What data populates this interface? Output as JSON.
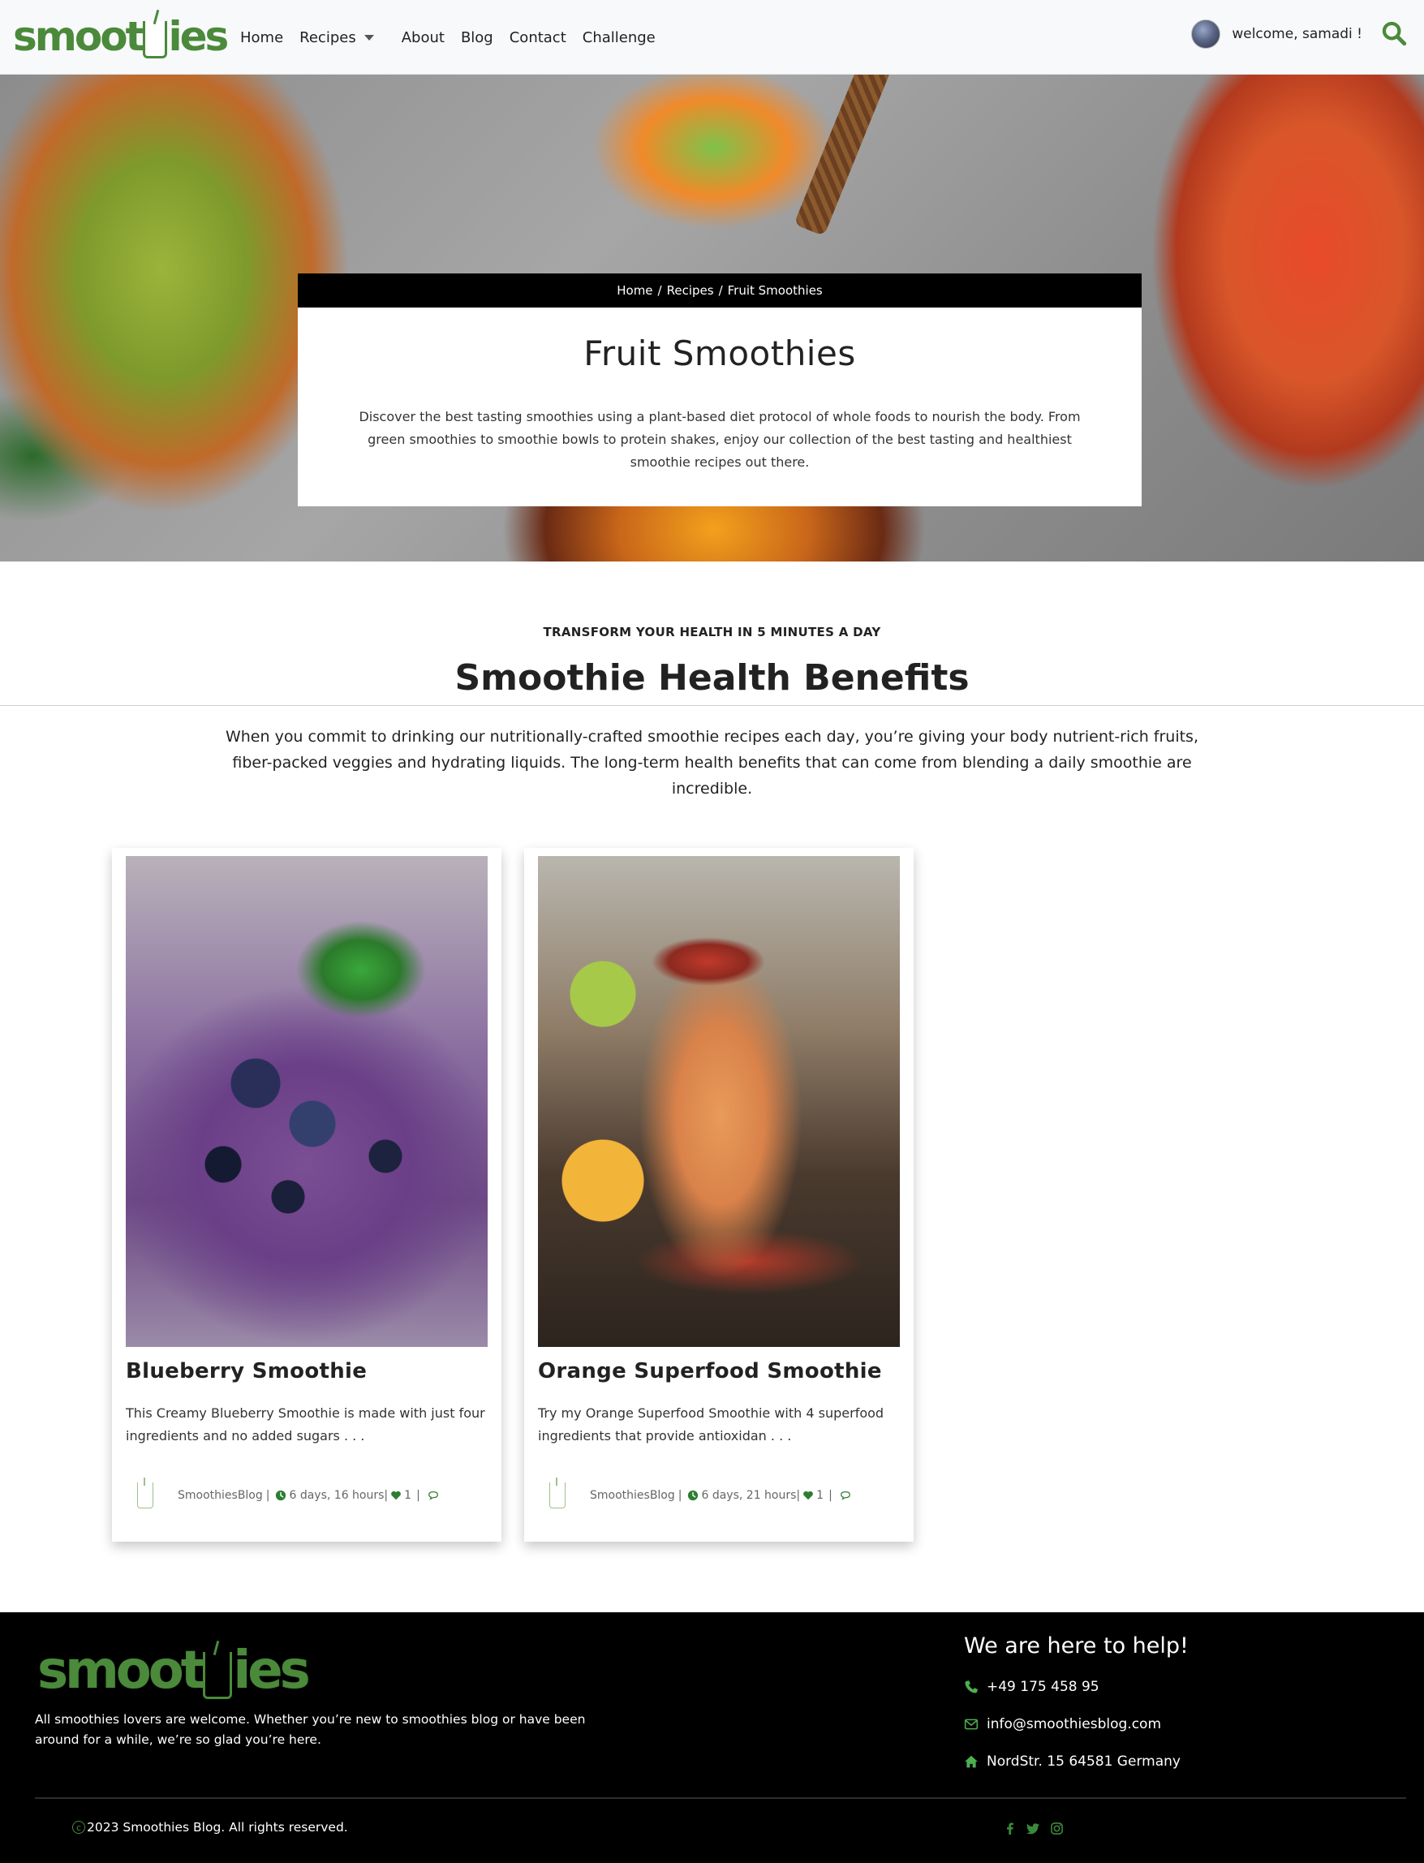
{
  "nav": {
    "logo_text": "smoothies",
    "links": [
      "Home",
      "Recipes",
      "About",
      "Blog",
      "Contact",
      "Challenge"
    ],
    "welcome": "welcome, samadi !"
  },
  "hero": {
    "breadcrumb": [
      "Home",
      "/",
      "Recipes",
      "/",
      "Fruit Smoothies"
    ],
    "title": "Fruit Smoothies",
    "description": "Discover the best tasting smoothies using a plant-based diet protocol of whole foods to nourish the body. From green smoothies to smoothie bowls to protein shakes, enjoy our collection of the best tasting and healthiest smoothie recipes out there."
  },
  "benefits": {
    "kicker": "TRANSFORM YOUR HEALTH IN 5 MINUTES A DAY",
    "title": "Smoothie Health Benefits",
    "description": "When you commit to drinking our nutritionally-crafted smoothie recipes each day, you’re giving your body nutrient-rich fruits, fiber-packed veggies and hydrating liquids. The long-term health benefits that can come from blending a daily smoothie are incredible."
  },
  "cards": [
    {
      "title": "Blueberry Smoothie",
      "description": "This Creamy Blueberry Smoothie is made with just four ingredients and no added sugars . . .",
      "author": "SmoothiesBlog",
      "sep1": "|",
      "time": "6 days, 16 hours|",
      "likes": "1",
      "sep2": "|"
    },
    {
      "title": "Orange Superfood Smoothie",
      "description": "Try my Orange Superfood Smoothie with 4 superfood ingredients that provide antioxidan . . .",
      "author": "SmoothiesBlog",
      "sep1": "|",
      "time": "6 days, 21 hours|",
      "likes": "1",
      "sep2": "|"
    }
  ],
  "footer": {
    "logo_text": "smoothies",
    "about": "All smoothies lovers are welcome. Whether you’re new to smoothies blog or have been around for a while, we’re so glad you’re here.",
    "help_title": "We are here to help!",
    "phone": "+49 175 458 95",
    "email": "info@smoothiesblog.com",
    "address": "NordStr. 15 64581 Germany",
    "copyright": "2023 Smoothies Blog. All rights reserved."
  },
  "colors": {
    "brand_green": "#4a8a3a",
    "footer_bg": "#000000",
    "breadcrumb_bg": "#000000"
  },
  "icons": [
    "search-icon",
    "avatar",
    "chevron-down-icon",
    "clock-icon",
    "heart-icon",
    "comment-icon",
    "phone-icon",
    "envelope-icon",
    "home-icon",
    "facebook-icon",
    "twitter-icon",
    "instagram-icon",
    "copyright-icon"
  ]
}
